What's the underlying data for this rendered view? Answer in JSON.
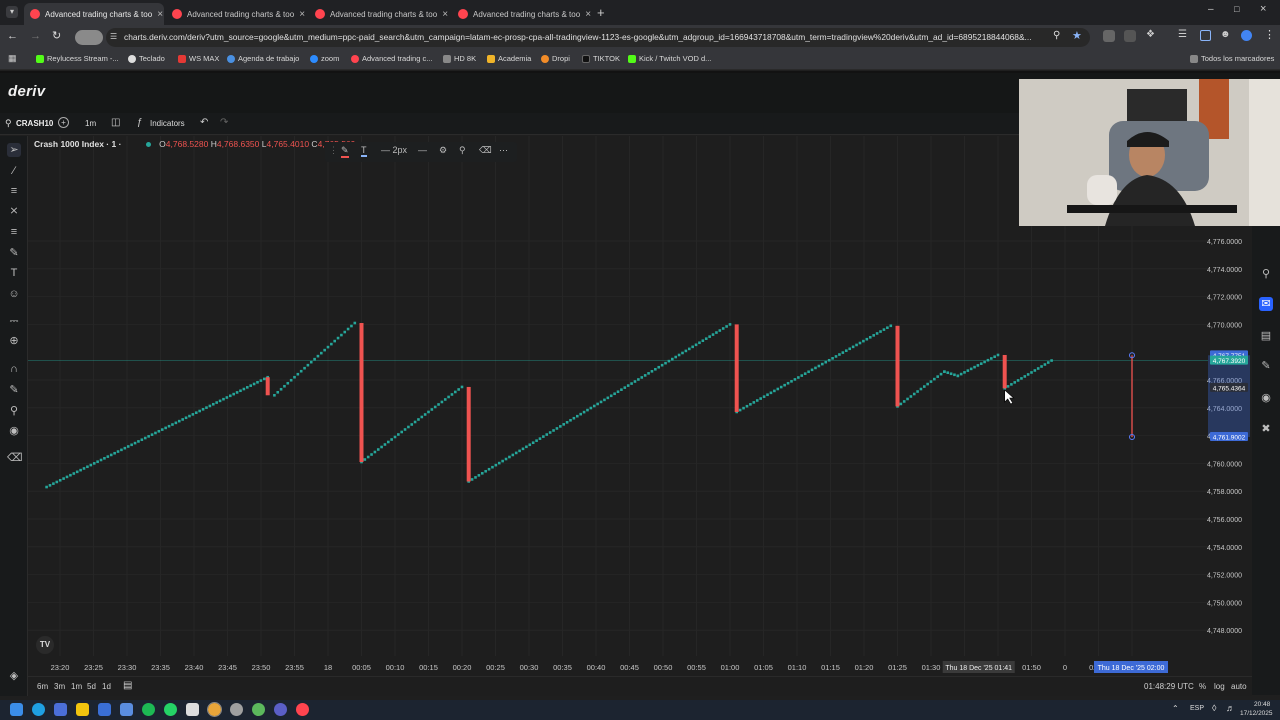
{
  "browser": {
    "tabs": [
      {
        "title": "Advanced trading charts & too",
        "active": true
      },
      {
        "title": "Advanced trading charts & too",
        "active": false
      },
      {
        "title": "Advanced trading charts & too",
        "active": false
      },
      {
        "title": "Advanced trading charts & too",
        "active": false
      }
    ],
    "url": "charts.deriv.com/deriv?utm_source=google&utm_medium=ppc-paid_search&utm_campaign=latam-ec-prosp-cpa-all-tradingview-1123-es-google&utm_adgroup_id=166943718708&utm_term=tradingview%20deriv&utm_ad_id=6895218844068&...",
    "bookmarks": [
      "Reylucess Stream -...",
      "Teclado",
      "WS MAX",
      "Agenda de trabajo",
      "zoom",
      "Advanced trading c...",
      "HD 8K",
      "Academia",
      "Dropi",
      "TIKTOK",
      "Kick / Twitch VOD d..."
    ],
    "all_bookmarks": "Todos los marcadores"
  },
  "app": {
    "logo": "deriv"
  },
  "toolbar": {
    "symbol": "CRASH10",
    "interval": "1m",
    "indicators_label": "Indicators"
  },
  "legend": {
    "title": "Crash 1000 Index · 1 ·",
    "o_label": "O",
    "o_value": "4,768.5280",
    "h_label": "H",
    "h_value": "4,768.6350",
    "l_label": "L",
    "l_value": "4,765.4010",
    "c_label": "C",
    "c_value": "4,765.569"
  },
  "draw_toolbar": {
    "width_label": "2px"
  },
  "price_axis": {
    "ticks": [
      "4,776.0000",
      "4,774.0000",
      "4,772.0000",
      "4,770.0000",
      "4,766.0000",
      "4,764.0000",
      "4,762.0000",
      "4,760.0000",
      "4,758.0000",
      "4,756.0000",
      "4,754.0000",
      "4,752.0000",
      "4,750.0000",
      "4,748.0000"
    ],
    "labels": [
      {
        "text": "4,767.7751",
        "color": "#3d6ad6"
      },
      {
        "text": "4,767.3920",
        "color": "#26a69a"
      },
      {
        "text": "4,765.4364",
        "color": "#2a2e39"
      },
      {
        "text": "4,761.9002",
        "color": "#3d6ad6"
      }
    ]
  },
  "time_axis": {
    "ticks": [
      "23:20",
      "23:25",
      "23:30",
      "23:35",
      "23:40",
      "23:45",
      "23:50",
      "23:55",
      "18",
      "00:05",
      "00:10",
      "00:15",
      "00:20",
      "00:25",
      "00:30",
      "00:35",
      "00:40",
      "00:45",
      "00:50",
      "00:55",
      "01:00",
      "01:05",
      "01:10",
      "01:15",
      "01:20",
      "01:25",
      "01:30",
      "01:3",
      "01:41",
      "01:50",
      "0",
      "02:05",
      "02:10"
    ],
    "crosshair_label": "Thu 18 Dec '25   01:41",
    "measure_label": "Thu 18 Dec '25   02:00"
  },
  "bottom": {
    "ranges": [
      "6m",
      "3m",
      "1m",
      "5d",
      "1d"
    ],
    "clock": "01:48:29 UTC",
    "pct": "%",
    "log": "log",
    "auto": "auto"
  },
  "taskbar": {
    "lang": "ESP",
    "time": "20:48",
    "date": "17/12/2025"
  },
  "chart_data": {
    "type": "line",
    "title": "Crash 1000 Index",
    "xlabel": "",
    "ylabel": "",
    "ylim": [
      4747,
      4777
    ],
    "series": [
      {
        "points": [
          [
            "23:18",
            4758.3
          ],
          [
            "23:51",
            4766.2
          ],
          [
            "23:52",
            4764.9
          ],
          [
            "00:04",
            4770.1
          ],
          [
            "00:05",
            4760.1
          ],
          [
            "00:20",
            4765.5
          ],
          [
            "00:21",
            4758.7
          ],
          [
            "01:00",
            4770.0
          ],
          [
            "01:01",
            4763.7
          ],
          [
            "01:24",
            4769.9
          ],
          [
            "01:25",
            4764.1
          ],
          [
            "01:32",
            4766.6
          ],
          [
            "01:34",
            4766.3
          ],
          [
            "01:40",
            4767.8
          ],
          [
            "01:41",
            4765.4
          ],
          [
            "01:48",
            4767.4
          ]
        ]
      }
    ],
    "spikes": [
      {
        "time": "23:51",
        "from": 4766.2,
        "to": 4764.9
      },
      {
        "time": "00:05",
        "from": 4770.1,
        "to": 4760.1
      },
      {
        "time": "00:21",
        "from": 4765.5,
        "to": 4758.7
      },
      {
        "time": "01:01",
        "from": 4770.0,
        "to": 4763.7
      },
      {
        "time": "01:25",
        "from": 4769.9,
        "to": 4764.1
      },
      {
        "time": "01:41",
        "from": 4767.8,
        "to": 4765.4
      }
    ],
    "measure": {
      "time": "02:00",
      "from": 4767.78,
      "to": 4761.9
    }
  }
}
